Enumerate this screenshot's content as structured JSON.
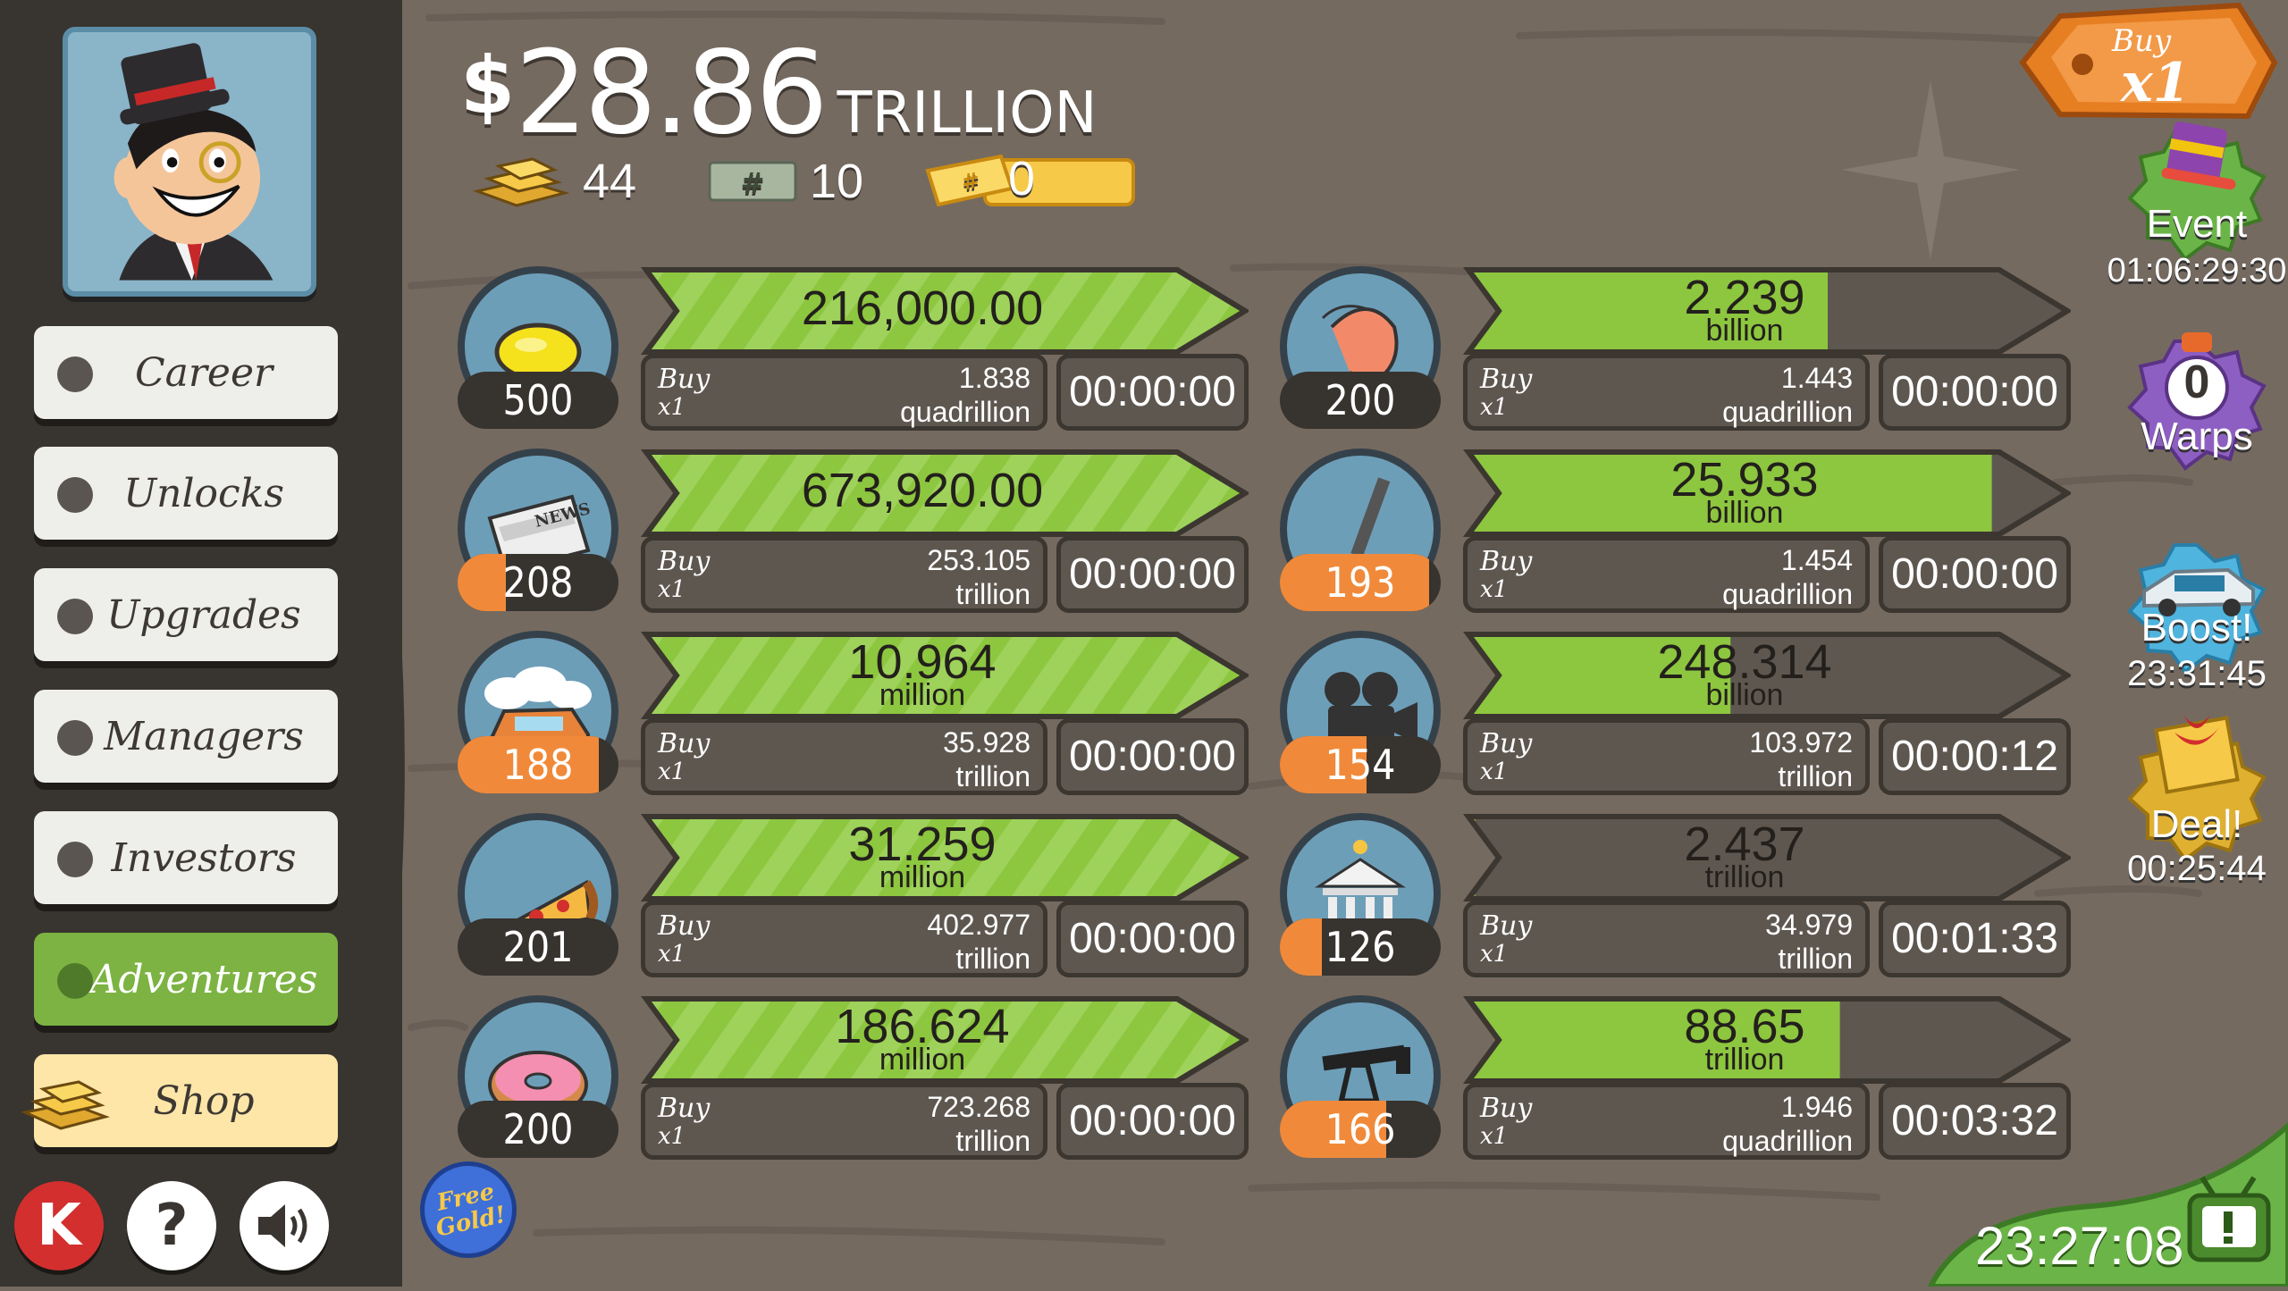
{
  "balance": {
    "symbol": "$",
    "amount": "28.86",
    "unit": "TRILLION"
  },
  "currencies": {
    "gold": "44",
    "megabucks": "10",
    "tickets": "0"
  },
  "buy_multiplier": {
    "label": "Buy",
    "value": "x1"
  },
  "nav": {
    "career": "Career",
    "unlocks": "Unlocks",
    "upgrades": "Upgrades",
    "managers": "Managers",
    "investors": "Investors",
    "adventures": "Adventures",
    "shop": "Shop"
  },
  "bottom_buttons": {
    "k": "K",
    "help": "?"
  },
  "free_gold": "Free Gold!",
  "businesses": [
    {
      "id": "lemonade",
      "icon": "lemon-icon",
      "owned": "500",
      "owned_progress": 0,
      "revenue": "216,000.00",
      "revenue_unit": "",
      "progress": 1.0,
      "buy_label": "Buy",
      "buy_qty": "x1",
      "cost": "1.838",
      "cost_unit": "quadrillion",
      "timer": "00:00:00"
    },
    {
      "id": "newspaper",
      "icon": "newspaper-icon",
      "owned": "208",
      "owned_progress": 0.3,
      "revenue": "673,920.00",
      "revenue_unit": "",
      "progress": 1.0,
      "buy_label": "Buy",
      "buy_qty": "x1",
      "cost": "253.105",
      "cost_unit": "trillion",
      "timer": "00:00:00"
    },
    {
      "id": "carwash",
      "icon": "car-wash-icon",
      "owned": "188",
      "owned_progress": 0.88,
      "revenue": "10.964",
      "revenue_unit": "million",
      "progress": 1.0,
      "buy_label": "Buy",
      "buy_qty": "x1",
      "cost": "35.928",
      "cost_unit": "trillion",
      "timer": "00:00:00"
    },
    {
      "id": "pizza",
      "icon": "pizza-icon",
      "owned": "201",
      "owned_progress": 0,
      "revenue": "31.259",
      "revenue_unit": "million",
      "progress": 1.0,
      "buy_label": "Buy",
      "buy_qty": "x1",
      "cost": "402.977",
      "cost_unit": "trillion",
      "timer": "00:00:00"
    },
    {
      "id": "donut",
      "icon": "donut-icon",
      "owned": "200",
      "owned_progress": 0,
      "revenue": "186.624",
      "revenue_unit": "million",
      "progress": 1.0,
      "buy_label": "Buy",
      "buy_qty": "x1",
      "cost": "723.268",
      "cost_unit": "trillion",
      "timer": "00:00:00"
    },
    {
      "id": "shrimp",
      "icon": "shrimp-icon",
      "owned": "200",
      "owned_progress": 0,
      "revenue": "2.239",
      "revenue_unit": "billion",
      "progress": 0.6,
      "buy_label": "Buy",
      "buy_qty": "x1",
      "cost": "1.443",
      "cost_unit": "quadrillion",
      "timer": "00:00:00"
    },
    {
      "id": "hockey",
      "icon": "hockey-icon",
      "owned": "193",
      "owned_progress": 0.93,
      "revenue": "25.933",
      "revenue_unit": "billion",
      "progress": 0.87,
      "buy_label": "Buy",
      "buy_qty": "x1",
      "cost": "1.454",
      "cost_unit": "quadrillion",
      "timer": "00:00:00"
    },
    {
      "id": "movie",
      "icon": "movie-camera-icon",
      "owned": "154",
      "owned_progress": 0.54,
      "revenue": "248.314",
      "revenue_unit": "billion",
      "progress": 0.44,
      "buy_label": "Buy",
      "buy_qty": "x1",
      "cost": "103.972",
      "cost_unit": "trillion",
      "timer": "00:00:12"
    },
    {
      "id": "bank",
      "icon": "bank-icon",
      "owned": "126",
      "owned_progress": 0.26,
      "revenue": "2.437",
      "revenue_unit": "trillion",
      "progress": 0.02,
      "buy_label": "Buy",
      "buy_qty": "x1",
      "cost": "34.979",
      "cost_unit": "trillion",
      "timer": "00:01:33"
    },
    {
      "id": "oil",
      "icon": "oil-rig-icon",
      "owned": "166",
      "owned_progress": 0.66,
      "revenue": "88.65",
      "revenue_unit": "trillion",
      "progress": 0.62,
      "buy_label": "Buy",
      "buy_qty": "x1",
      "cost": "1.946",
      "cost_unit": "quadrillion",
      "timer": "00:03:32"
    }
  ],
  "side": {
    "event": {
      "label": "Event",
      "time": "01:06:29:30"
    },
    "warps": {
      "count": "0",
      "label": "Warps"
    },
    "boost": {
      "label": "Boost!",
      "time": "23:31:45"
    },
    "deal": {
      "label": "Deal!",
      "time": "00:25:44"
    }
  },
  "tv_timer": "23:27:08",
  "colors": {
    "bar_green": "#8dc63f",
    "accent_orange": "#f08a3a",
    "sidebar": "#38342f"
  }
}
